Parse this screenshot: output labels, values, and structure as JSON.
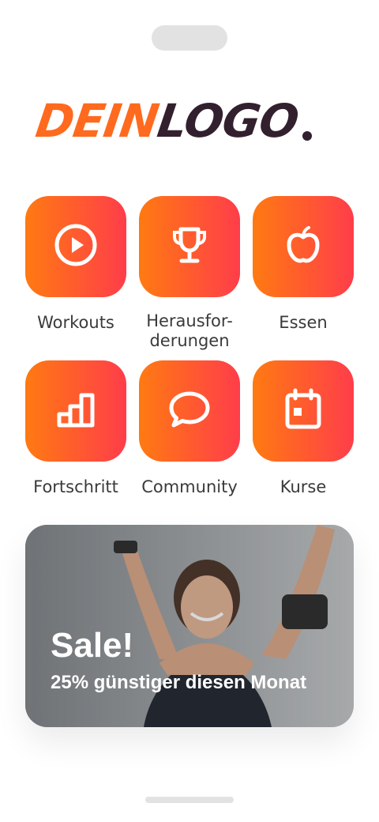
{
  "logo": {
    "part_a": "DEIN",
    "part_b": "LOGO"
  },
  "tiles": [
    {
      "label": "Workouts",
      "icon": "play-circle-icon"
    },
    {
      "label": "Herausfor-\nderungen",
      "icon": "trophy-icon"
    },
    {
      "label": "Essen",
      "icon": "apple-icon"
    },
    {
      "label": "Fortschritt",
      "icon": "bar-chart-icon"
    },
    {
      "label": "Community",
      "icon": "chat-bubble-icon"
    },
    {
      "label": "Kurse",
      "icon": "calendar-icon"
    }
  ],
  "banner": {
    "title": "Sale!",
    "subtitle": "25% günstiger diesen Monat"
  },
  "colors": {
    "gradient_start": "#ff7a12",
    "gradient_end": "#ff3d4a",
    "logo_orange": "#ff6a1e",
    "logo_dark": "#33202e"
  }
}
